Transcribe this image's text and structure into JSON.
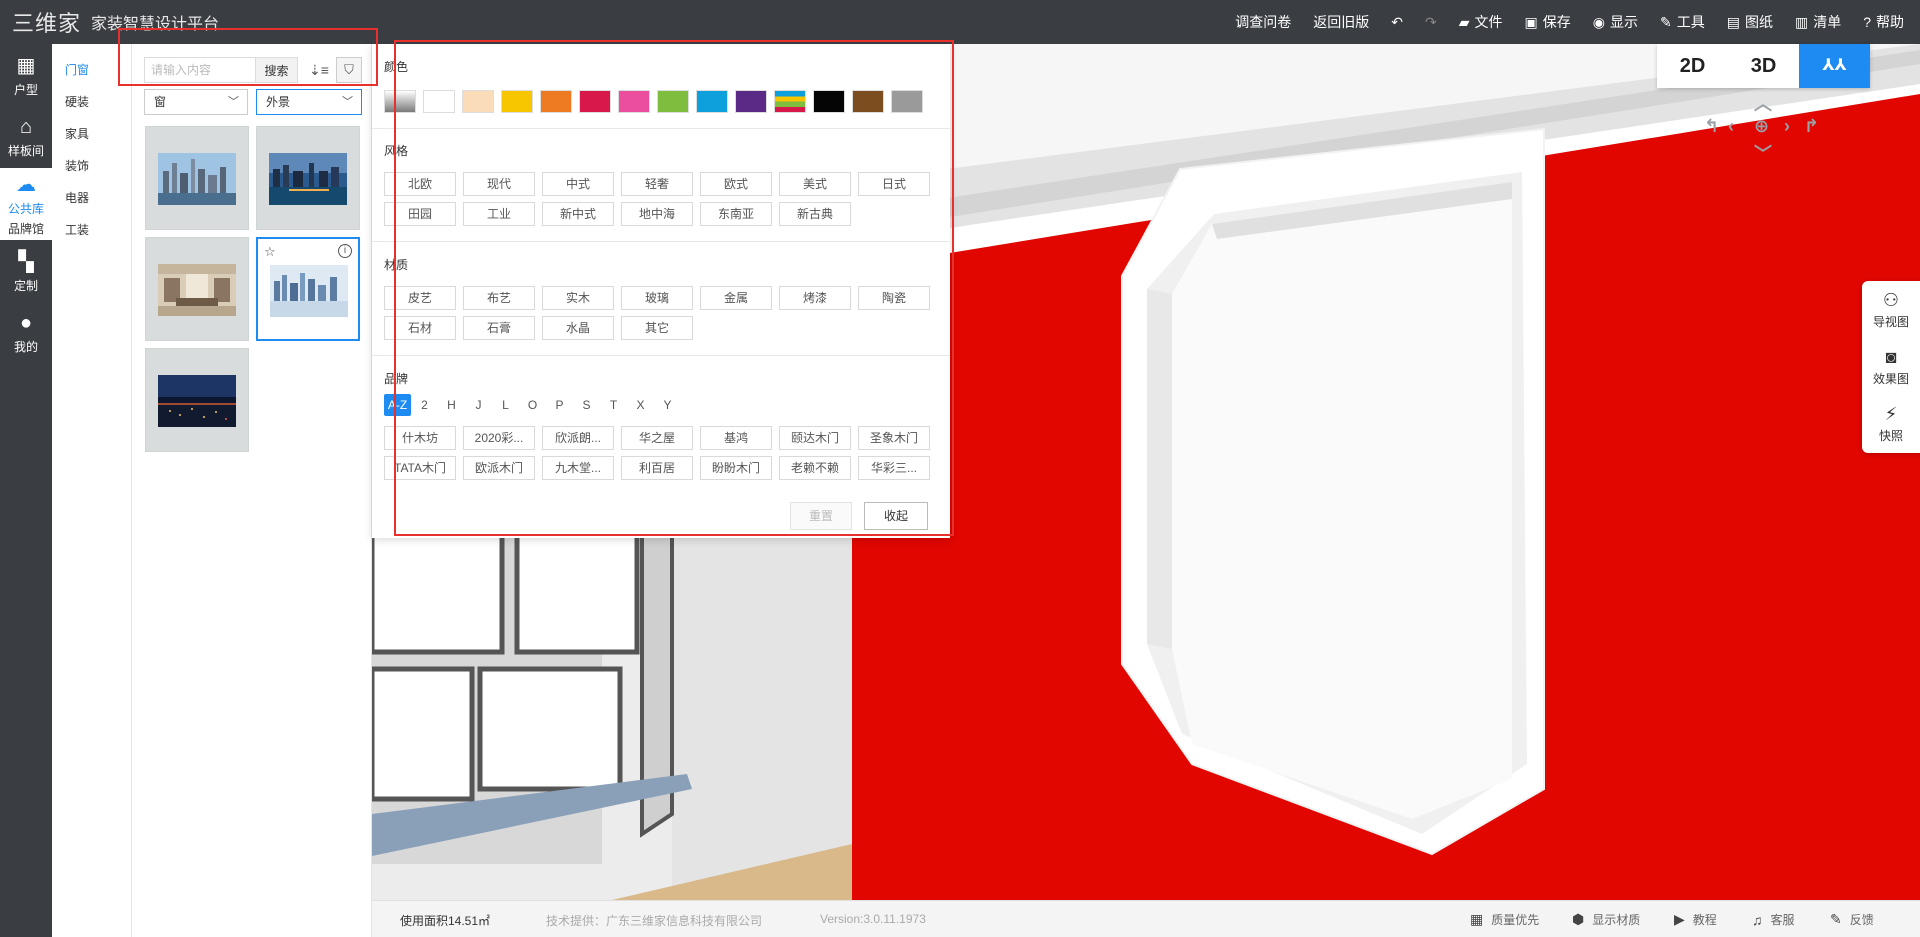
{
  "app": {
    "logo_mark": "三维家",
    "title": "家装智慧设计平台"
  },
  "topmenu": [
    {
      "label": "调查问卷",
      "icon": ""
    },
    {
      "label": "返回旧版",
      "icon": ""
    },
    {
      "label": "",
      "icon": "undo-icon"
    },
    {
      "label": "",
      "icon": "redo-icon"
    },
    {
      "label": "文件",
      "icon": "folder-icon"
    },
    {
      "label": "保存",
      "icon": "save-icon"
    },
    {
      "label": "显示",
      "icon": "eye-icon"
    },
    {
      "label": "工具",
      "icon": "wrench-icon"
    },
    {
      "label": "图纸",
      "icon": "map-icon"
    },
    {
      "label": "清单",
      "icon": "list-icon"
    },
    {
      "label": "帮助",
      "icon": "help-icon"
    }
  ],
  "rail": [
    {
      "label": "户型",
      "icon": "floorplan-icon"
    },
    {
      "label": "样板间",
      "icon": "house-icon"
    },
    {
      "label": "公共库",
      "sub": "品牌馆",
      "icon": "cloud-icon",
      "active": true
    },
    {
      "label": "定制",
      "icon": "blocks-icon"
    },
    {
      "label": "我的",
      "icon": "user-icon"
    }
  ],
  "categories": [
    "门窗",
    "硬装",
    "家具",
    "装饰",
    "电器",
    "工装"
  ],
  "library": {
    "search_placeholder": "请输入内容",
    "search_button": "搜索",
    "select_type": "窗",
    "select_view": "外景"
  },
  "filter": {
    "color_title": "颜色",
    "colors": [
      "#8a8a8a",
      "#ffffff",
      "#fbdcb8",
      "#f7c600",
      "#ee7a22",
      "#d8174a",
      "#ea4e9c",
      "#7ebd3e",
      "#0da0dc",
      "#5b2a86",
      "multi",
      "#050505",
      "#7c4d1e",
      "#9a9a9a"
    ],
    "style_title": "风格",
    "styles": [
      "北欧",
      "现代",
      "中式",
      "轻奢",
      "欧式",
      "美式",
      "日式",
      "田园",
      "工业",
      "新中式",
      "地中海",
      "东南亚",
      "新古典"
    ],
    "material_title": "材质",
    "materials": [
      "皮艺",
      "布艺",
      "实木",
      "玻璃",
      "金属",
      "烤漆",
      "陶瓷",
      "石材",
      "石膏",
      "水晶",
      "其它"
    ],
    "brand_title": "品牌",
    "letters": [
      "A-Z",
      "2",
      "H",
      "J",
      "L",
      "O",
      "P",
      "S",
      "T",
      "X",
      "Y"
    ],
    "brands": [
      "什木坊",
      "2020彩...",
      "欣派朗...",
      "华之屋",
      "基鸿",
      "颐达木门",
      "圣象木门",
      "TATA木门",
      "欧派木门",
      "九木堂...",
      "利百居",
      "盼盼木门",
      "老赖不赖",
      "华彩三..."
    ],
    "reset": "重置",
    "collapse": "收起"
  },
  "viewtoggle": {
    "v2d": "2D",
    "v3d": "3D"
  },
  "righttools": [
    {
      "label": "导视图",
      "icon": "navview-icon"
    },
    {
      "label": "效果图",
      "icon": "camera-icon"
    },
    {
      "label": "快照",
      "icon": "snapshot-icon"
    }
  ],
  "status": {
    "area": "使用面积14.51㎡",
    "provider": "技术提供：广东三维家信息科技有限公司",
    "version": "Version:3.0.11.1973",
    "items": [
      {
        "label": "质量优先",
        "icon": "quality-icon"
      },
      {
        "label": "显示材质",
        "icon": "cube-icon"
      },
      {
        "label": "教程",
        "icon": "play-icon"
      },
      {
        "label": "客服",
        "icon": "headset-icon"
      },
      {
        "label": "反馈",
        "icon": "edit-icon"
      }
    ]
  },
  "colors": {
    "accent": "#1d8bf1",
    "topbar": "#3a3d42",
    "wall_red": "#e10600",
    "annotation_red": "#e8302c"
  }
}
